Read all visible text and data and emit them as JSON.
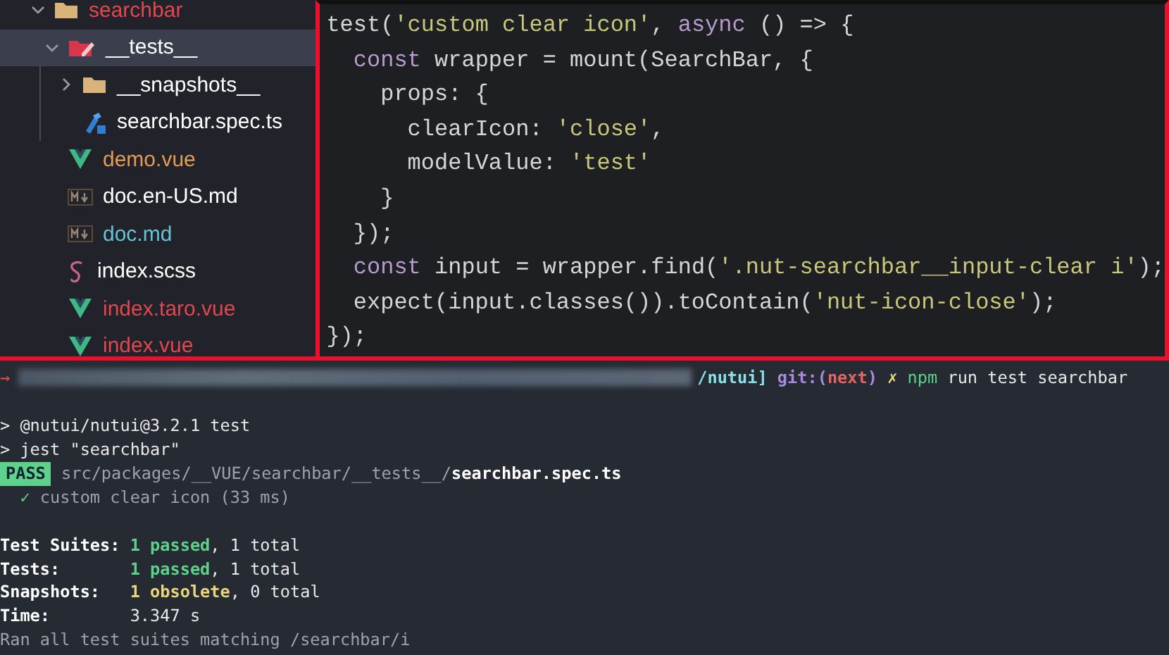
{
  "explorer": {
    "items": [
      {
        "label": "searchbar",
        "kind": "folder",
        "expanded": true,
        "selected": false,
        "color": "#e0474e",
        "children": [
          {
            "label": "__tests__",
            "kind": "test-folder",
            "expanded": true,
            "selected": true,
            "color": "#ffffff",
            "children": [
              {
                "label": "__snapshots__",
                "kind": "folder",
                "expanded": false,
                "selected": false,
                "color": "#ffffff"
              },
              {
                "label": "searchbar.spec.ts",
                "kind": "ts",
                "selected": false,
                "color": "#ffffff"
              }
            ]
          },
          {
            "label": "demo.vue",
            "kind": "vue",
            "selected": false,
            "color": "#e39c52"
          },
          {
            "label": "doc.en-US.md",
            "kind": "md",
            "selected": false,
            "color": "#ffffff"
          },
          {
            "label": "doc.md",
            "kind": "md",
            "selected": false,
            "color": "#64c3d6"
          },
          {
            "label": "index.scss",
            "kind": "scss",
            "selected": false,
            "color": "#ffffff"
          },
          {
            "label": "index.taro.vue",
            "kind": "vue",
            "selected": false,
            "color": "#e0474e"
          },
          {
            "label": "index.vue",
            "kind": "vue",
            "selected": false,
            "color": "#e0474e"
          }
        ]
      }
    ]
  },
  "code": {
    "lines": [
      [
        {
          "kind": "plain",
          "text": "test("
        },
        {
          "kind": "string",
          "text": "'custom clear icon'"
        },
        {
          "kind": "plain",
          "text": ", "
        },
        {
          "kind": "keyword",
          "text": "async"
        },
        {
          "kind": "plain",
          "text": " () => {"
        }
      ],
      [
        {
          "kind": "keyword",
          "text": "  const"
        },
        {
          "kind": "plain",
          "text": " wrapper = mount(SearchBar, {"
        }
      ],
      [
        {
          "kind": "plain",
          "text": "    props: {"
        }
      ],
      [
        {
          "kind": "plain",
          "text": "      clearIcon: "
        },
        {
          "kind": "string",
          "text": "'close'"
        },
        {
          "kind": "plain",
          "text": ","
        }
      ],
      [
        {
          "kind": "plain",
          "text": "      modelValue: "
        },
        {
          "kind": "string",
          "text": "'test'"
        }
      ],
      [
        {
          "kind": "plain",
          "text": "    }"
        }
      ],
      [
        {
          "kind": "plain",
          "text": "  });"
        }
      ],
      [
        {
          "kind": "keyword",
          "text": "  const"
        },
        {
          "kind": "plain",
          "text": " input = wrapper.find("
        },
        {
          "kind": "string",
          "text": "'.nut-searchbar__input-clear i'"
        },
        {
          "kind": "plain",
          "text": ");"
        }
      ],
      [
        {
          "kind": "plain",
          "text": "  expect(input.classes()).toContain("
        },
        {
          "kind": "string",
          "text": "'nut-icon-close'"
        },
        {
          "kind": "plain",
          "text": ");"
        }
      ],
      [
        {
          "kind": "plain",
          "text": "});"
        }
      ]
    ]
  },
  "terminal": {
    "lines": [
      {
        "kind": "text",
        "segments": [
          {
            "kind": "arrow",
            "text": "→"
          },
          {
            "kind": "redacted"
          },
          {
            "kind": "cyan",
            "text": "/nutui]"
          },
          {
            "kind": "purple",
            "text": " git:("
          },
          {
            "kind": "red",
            "text": "next"
          },
          {
            "kind": "purple",
            "text": ")"
          },
          {
            "kind": "yellow",
            "text": " ✗ "
          },
          {
            "kind": "green",
            "text": "npm"
          },
          {
            "kind": "plain",
            "text": " run test searchbar"
          }
        ]
      },
      {
        "kind": "blank"
      },
      {
        "kind": "text",
        "segments": [
          {
            "kind": "plain",
            "text": "> @nutui/nutui@3.2.1 test"
          }
        ]
      },
      {
        "kind": "text",
        "segments": [
          {
            "kind": "plain",
            "text": "> jest \"searchbar\""
          }
        ]
      },
      {
        "kind": "text",
        "segments": [
          {
            "kind": "badge",
            "text": "PASS"
          },
          {
            "kind": "dim",
            "text": " src/packages/__VUE/searchbar/__tests__/"
          },
          {
            "kind": "bold",
            "text": "searchbar.spec.ts"
          }
        ]
      },
      {
        "kind": "text",
        "segments": [
          {
            "kind": "check",
            "text": "  ✓"
          },
          {
            "kind": "dim",
            "text": " custom clear icon (33 ms)"
          }
        ]
      },
      {
        "kind": "blank"
      },
      {
        "kind": "text",
        "segments": [
          {
            "kind": "bold",
            "text": "Test Suites: "
          },
          {
            "kind": "pass",
            "text": "1 passed"
          },
          {
            "kind": "plain",
            "text": ", 1 total"
          }
        ]
      },
      {
        "kind": "text",
        "segments": [
          {
            "kind": "bold",
            "text": "Tests:       "
          },
          {
            "kind": "pass",
            "text": "1 passed"
          },
          {
            "kind": "plain",
            "text": ", 1 total"
          }
        ]
      },
      {
        "kind": "text",
        "segments": [
          {
            "kind": "bold",
            "text": "Snapshots:   "
          },
          {
            "kind": "warn",
            "text": "1 obsolete"
          },
          {
            "kind": "plain",
            "text": ", 0 total"
          }
        ]
      },
      {
        "kind": "text",
        "segments": [
          {
            "kind": "bold",
            "text": "Time:"
          },
          {
            "kind": "plain",
            "text": "        3.347 s"
          }
        ]
      },
      {
        "kind": "text",
        "segments": [
          {
            "kind": "dim",
            "text": "Ran all test suites matching /searchbar/i"
          }
        ]
      }
    ]
  }
}
